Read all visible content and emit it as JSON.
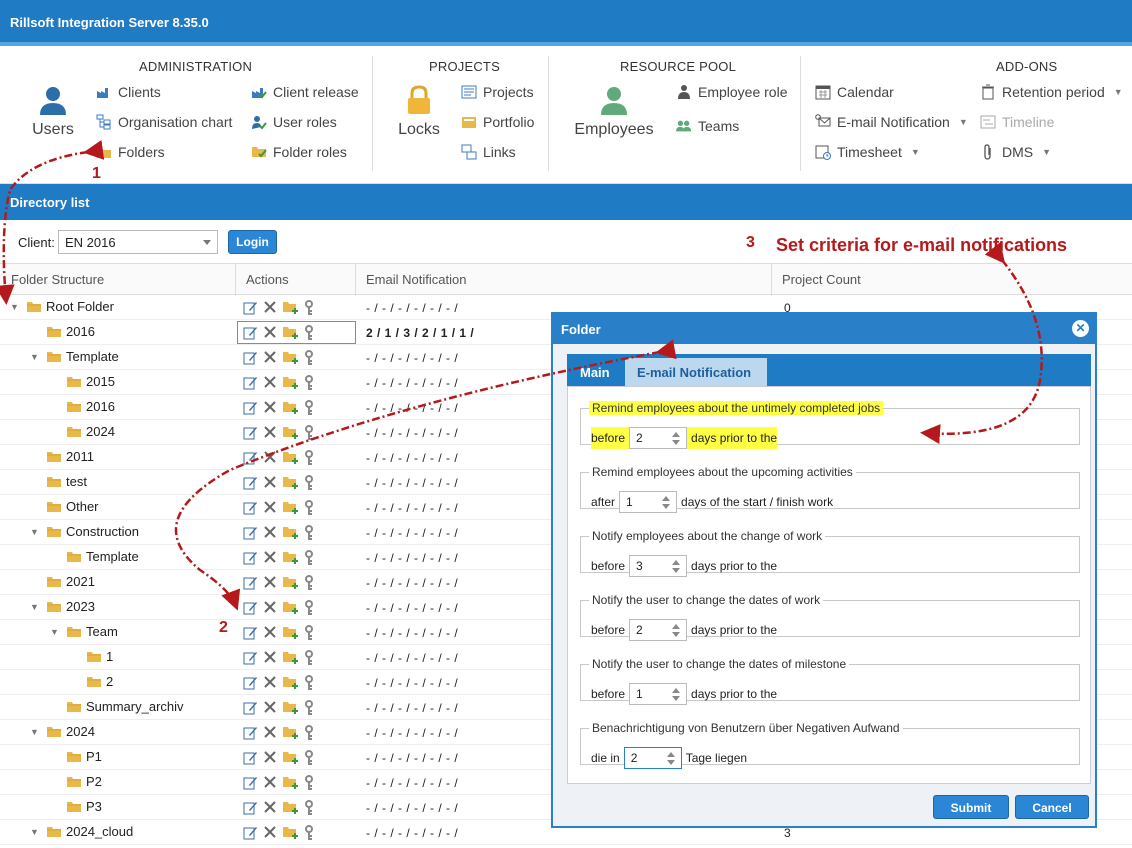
{
  "app": {
    "title": "Rillsoft Integration Server 8.35.0"
  },
  "ribbon": {
    "administration": {
      "title": "ADMINISTRATION",
      "users": "Users",
      "clients": "Clients",
      "org_chart": "Organisation chart",
      "folders": "Folders",
      "client_release": "Client release",
      "user_roles": "User roles",
      "folder_roles": "Folder roles"
    },
    "projects": {
      "title": "PROJECTS",
      "locks": "Locks",
      "projects": "Projects",
      "portfolio": "Portfolio",
      "links": "Links"
    },
    "resource_pool": {
      "title": "RESOURCE POOL",
      "employees": "Employees",
      "employee_role": "Employee role",
      "teams": "Teams"
    },
    "addons": {
      "title": "ADD-ONS",
      "calendar": "Calendar",
      "email_notification": "E-mail Notification",
      "timesheet": "Timesheet",
      "retention_period": "Retention period",
      "timeline": "Timeline",
      "dms": "DMS"
    }
  },
  "panel": {
    "title": "Directory list"
  },
  "client": {
    "label": "Client:",
    "value": "EN 2016",
    "login": "Login"
  },
  "grid": {
    "headers": {
      "folder": "Folder Structure",
      "actions": "Actions",
      "email": "Email Notification",
      "count": "Project Count"
    },
    "rows": [
      {
        "name": "Root Folder",
        "indent": 0,
        "expand": "open",
        "mail": "- / - / - / - / - / - /",
        "count": "0"
      },
      {
        "name": "2016",
        "indent": 1,
        "expand": "",
        "mail": "2 / 1 / 3 / 2 / 1 / 1 /",
        "count": ""
      },
      {
        "name": "Template",
        "indent": 1,
        "expand": "open",
        "mail": "- / - / - / - / - / - /",
        "count": ""
      },
      {
        "name": "2015",
        "indent": 2,
        "expand": "",
        "mail": "- / - / - / - / - / - /",
        "count": ""
      },
      {
        "name": "2016",
        "indent": 2,
        "expand": "",
        "mail": "- / - / - / - / - / - /",
        "count": ""
      },
      {
        "name": "2024",
        "indent": 2,
        "expand": "",
        "mail": "- / - / - / - / - / - /",
        "count": ""
      },
      {
        "name": "2011",
        "indent": 1,
        "expand": "",
        "mail": "- / - / - / - / - / - /",
        "count": ""
      },
      {
        "name": "test",
        "indent": 1,
        "expand": "",
        "mail": "- / - / - / - / - / - /",
        "count": ""
      },
      {
        "name": "Other",
        "indent": 1,
        "expand": "",
        "mail": "- / - / - / - / - / - /",
        "count": ""
      },
      {
        "name": "Construction",
        "indent": 1,
        "expand": "open",
        "mail": "- / - / - / - / - / - /",
        "count": ""
      },
      {
        "name": "Template",
        "indent": 2,
        "expand": "",
        "mail": "- / - / - / - / - / - /",
        "count": ""
      },
      {
        "name": "2021",
        "indent": 1,
        "expand": "",
        "mail": "- / - / - / - / - / - /",
        "count": ""
      },
      {
        "name": "2023",
        "indent": 1,
        "expand": "open",
        "mail": "- / - / - / - / - / - /",
        "count": ""
      },
      {
        "name": "Team",
        "indent": 2,
        "expand": "open",
        "mail": "- / - / - / - / - / - /",
        "count": ""
      },
      {
        "name": "1",
        "indent": 3,
        "expand": "",
        "mail": "- / - / - / - / - / - /",
        "count": ""
      },
      {
        "name": "2",
        "indent": 3,
        "expand": "",
        "mail": "- / - / - / - / - / - /",
        "count": ""
      },
      {
        "name": "Summary_archiv",
        "indent": 2,
        "expand": "",
        "mail": "- / - / - / - / - / - /",
        "count": ""
      },
      {
        "name": "2024",
        "indent": 1,
        "expand": "open",
        "mail": "- / - / - / - / - / - /",
        "count": ""
      },
      {
        "name": "P1",
        "indent": 2,
        "expand": "",
        "mail": "- / - / - / - / - / - /",
        "count": ""
      },
      {
        "name": "P2",
        "indent": 2,
        "expand": "",
        "mail": "- / - / - / - / - / - /",
        "count": ""
      },
      {
        "name": "P3",
        "indent": 2,
        "expand": "",
        "mail": "- / - / - / - / - / - /",
        "count": ""
      },
      {
        "name": "2024_cloud",
        "indent": 1,
        "expand": "open",
        "mail": "- / - / - / - / - / - /",
        "count": "3"
      }
    ]
  },
  "dialog": {
    "title": "Folder",
    "tabs": [
      "Main",
      "E-mail Notification"
    ],
    "sections": [
      {
        "legend": "Remind employees about the untimely completed jobs",
        "prefix": "before",
        "value": "2",
        "suffix": "days prior to the"
      },
      {
        "legend": "Remind employees about the upcoming activities",
        "prefix": "after",
        "value": "1",
        "suffix": "days of the start / finish work"
      },
      {
        "legend": "Notify employees about the change of work",
        "prefix": "before",
        "value": "3",
        "suffix": "days prior to the"
      },
      {
        "legend": "Notify the user to change the dates of work",
        "prefix": "before",
        "value": "2",
        "suffix": "days prior to the"
      },
      {
        "legend": "Notify the user to change the dates of milestone",
        "prefix": "before",
        "value": "1",
        "suffix": "days prior to the"
      },
      {
        "legend": "Benachrichtigung von Benutzern über Negativen Aufwand",
        "prefix": "die in",
        "value": "2",
        "suffix": "Tage liegen"
      }
    ],
    "submit": "Submit",
    "cancel": "Cancel"
  },
  "annotations": {
    "n1": "1",
    "n2": "2",
    "n3": "3",
    "criteria": "Set criteria for e-mail notifications"
  },
  "colors": {
    "primary": "#1f7bc4",
    "annotation": "#b5191b",
    "highlight": "#ffff44"
  }
}
